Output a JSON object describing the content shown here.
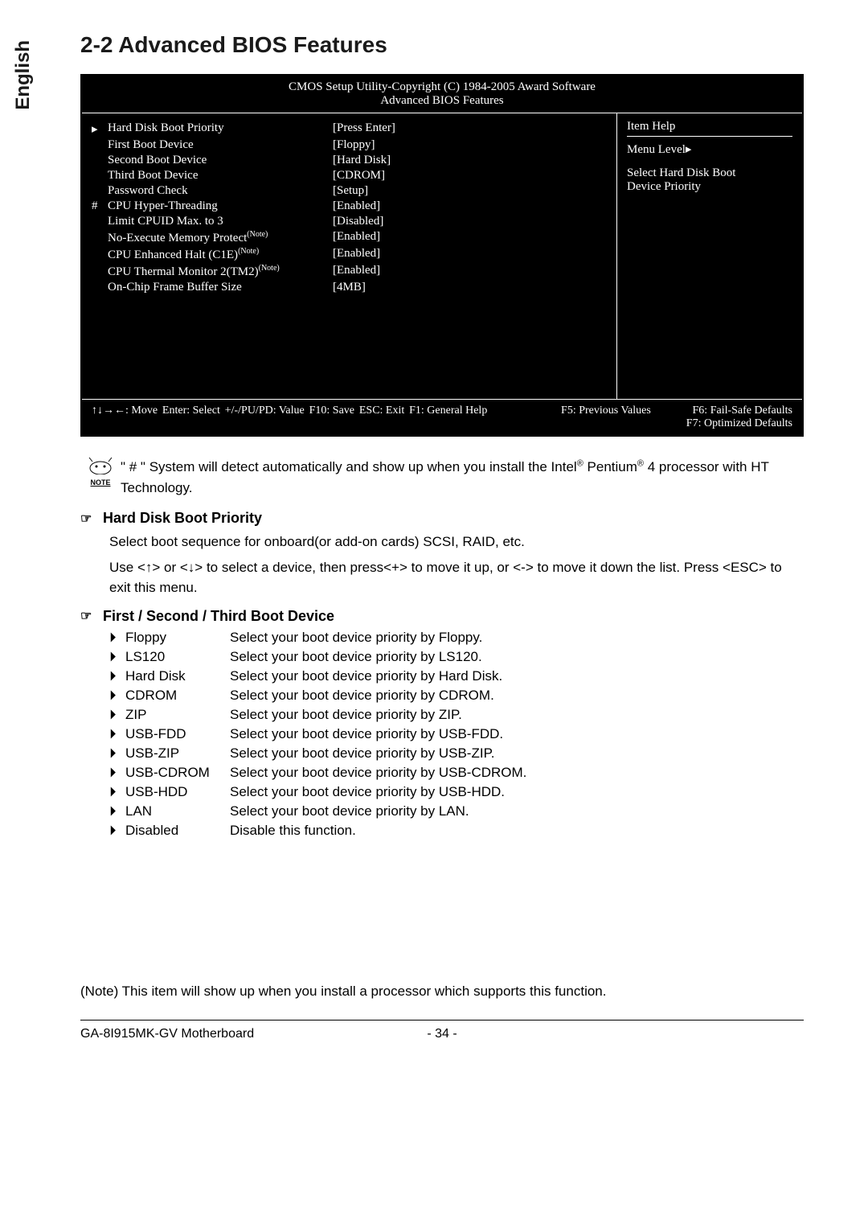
{
  "side_label": "English",
  "title": "2-2    Advanced BIOS Features",
  "bios": {
    "header_line1": "CMOS Setup Utility-Copyright (C) 1984-2005 Award Software",
    "header_line2": "Advanced BIOS Features",
    "rows": [
      {
        "marker": "▸",
        "label": "Hard Disk Boot Priority",
        "value": "[Press Enter]",
        "note": ""
      },
      {
        "marker": "",
        "label": "First Boot Device",
        "value": "[Floppy]",
        "note": ""
      },
      {
        "marker": "",
        "label": "Second Boot Device",
        "value": "[Hard Disk]",
        "note": ""
      },
      {
        "marker": "",
        "label": "Third Boot Device",
        "value": "[CDROM]",
        "note": ""
      },
      {
        "marker": "",
        "label": "Password Check",
        "value": "[Setup]",
        "note": ""
      },
      {
        "marker": "#",
        "label": "CPU Hyper-Threading",
        "value": "[Enabled]",
        "note": ""
      },
      {
        "marker": "",
        "label": "Limit CPUID Max. to 3",
        "value": "[Disabled]",
        "note": ""
      },
      {
        "marker": "",
        "label": "No-Execute Memory Protect",
        "value": "[Enabled]",
        "note": "(Note)"
      },
      {
        "marker": "",
        "label": "CPU Enhanced Halt (C1E)",
        "value": "[Enabled]",
        "note": "(Note)"
      },
      {
        "marker": "",
        "label": "CPU Thermal Monitor 2(TM2)",
        "value": "[Enabled]",
        "note": "(Note)"
      },
      {
        "marker": "",
        "label": "On-Chip Frame Buffer Size",
        "value": "[4MB]",
        "note": ""
      }
    ],
    "right_title": "Item Help",
    "right_level": "Menu Level▸",
    "right_text1": "Select Hard Disk Boot",
    "right_text2": "Device Priority",
    "footer": {
      "f_move": "↑↓→←: Move",
      "f_enter": "Enter: Select",
      "f_pupd": "+/-/PU/PD: Value",
      "f_f10": "F10: Save",
      "f_esc": "ESC: Exit",
      "f_f1": "F1: General Help",
      "f_f5": "F5: Previous Values",
      "f_f6": "F6: Fail-Safe Defaults",
      "f_f7": "F7: Optimized Defaults"
    }
  },
  "note_label": "NOTE",
  "note_text_1": "\" # \" System will detect automatically and show up when you install the Intel",
  "note_text_2": " Pentium",
  "note_text_3": " 4 processor with HT Technology.",
  "sec1_title": "Hard Disk Boot Priority",
  "sec1_p1": "Select boot sequence for onboard(or add-on cards) SCSI, RAID, etc.",
  "sec1_p2": "Use <↑> or <↓> to select a device, then press<+> to move it up, or <-> to move it down the list. Press <ESC> to exit this menu.",
  "sec2_title": "First / Second / Third Boot Device",
  "options": [
    {
      "label": "Floppy",
      "desc": "Select your boot device priority by Floppy."
    },
    {
      "label": "LS120",
      "desc": "Select your boot device priority by LS120."
    },
    {
      "label": "Hard Disk",
      "desc": "Select your boot device priority by Hard Disk."
    },
    {
      "label": "CDROM",
      "desc": "Select your boot device priority by CDROM."
    },
    {
      "label": "ZIP",
      "desc": "Select your boot device priority by ZIP."
    },
    {
      "label": "USB-FDD",
      "desc": "Select your boot device priority by USB-FDD."
    },
    {
      "label": "USB-ZIP",
      "desc": "Select your boot device priority by USB-ZIP."
    },
    {
      "label": "USB-CDROM",
      "desc": "Select your boot device priority by USB-CDROM."
    },
    {
      "label": "USB-HDD",
      "desc": "Select your boot device priority by USB-HDD."
    },
    {
      "label": "LAN",
      "desc": "Select your boot device priority by LAN."
    },
    {
      "label": "Disabled",
      "desc": "Disable this function."
    }
  ],
  "bottom_note": "(Note)   This item will show up when you install a processor which supports this function.",
  "footer_model": "GA-8I915MK-GV Motherboard",
  "footer_page": "- 34 -"
}
